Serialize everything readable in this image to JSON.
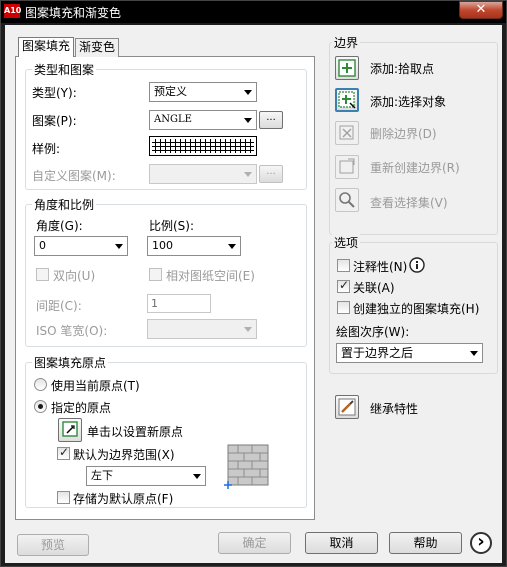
{
  "window": {
    "title": "图案填充和渐变色",
    "app_icon_text": "A10",
    "close_glyph": "✕"
  },
  "tabs": [
    {
      "label": "图案填充"
    },
    {
      "label": "渐变色"
    }
  ],
  "type_pattern": {
    "group_title": "类型和图案",
    "type_label": "类型(Y):",
    "type_value": "预定义",
    "pattern_label": "图案(P):",
    "pattern_value": "ANGLE",
    "swatch_label": "样例:",
    "custom_label": "自定义图案(M):",
    "custom_value": "",
    "browse_label": "..."
  },
  "angle_scale": {
    "group_title": "角度和比例",
    "angle_label": "角度(G):",
    "angle_value": "0",
    "scale_label": "比例(S):",
    "scale_value": "100",
    "double_label": "双向(U)",
    "relative_label": "相对图纸空间(E)",
    "spacing_label": "间距(C):",
    "spacing_value": "1",
    "iso_label": "ISO 笔宽(O):",
    "iso_value": ""
  },
  "origin": {
    "group_title": "图案填充原点",
    "current_label": "使用当前原点(T)",
    "specified_label": "指定的原点",
    "click_label": "单击以设置新原点",
    "default_extent_label": "默认为边界范围(X)",
    "position_value": "左下",
    "store_label": "存储为默认原点(F)"
  },
  "boundaries": {
    "group_title": "边界",
    "pick_points": "添加:拾取点",
    "select_objects": "添加:选择对象",
    "remove": "删除边界(D)",
    "recreate": "重新创建边界(R)",
    "view_selections": "查看选择集(V)"
  },
  "options": {
    "group_title": "选项",
    "annotative": "注释性(N)",
    "associative": "关联(A)",
    "separate": "创建独立的图案填充(H)",
    "draw_order_label": "绘图次序(W):",
    "draw_order_value": "置于边界之后"
  },
  "inherit": {
    "label": "继承特性"
  },
  "buttons": {
    "preview": "预览",
    "ok": "确定",
    "cancel": "取消",
    "help": "帮助",
    "more_glyph": "›"
  },
  "colors": {
    "accent": "#3c7fb1",
    "green_icon": "#2e8b3a",
    "title_bg": "#000000",
    "close_bg": "#c0482e"
  }
}
